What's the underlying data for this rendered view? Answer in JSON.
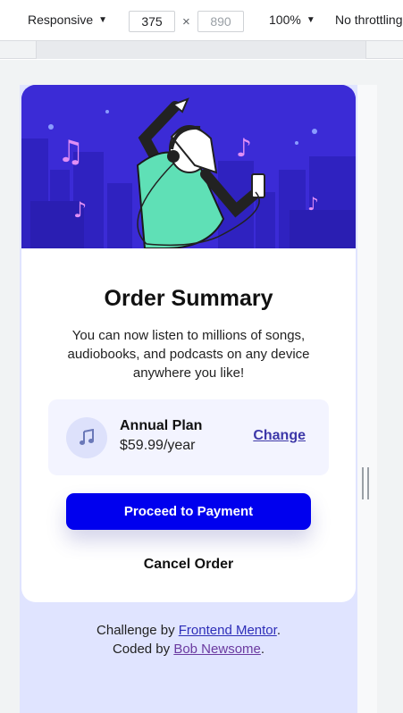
{
  "devtools": {
    "device_mode": "Responsive",
    "width": "375",
    "height": "890",
    "zoom": "100%",
    "throttling": "No throttling"
  },
  "card": {
    "title": "Order Summary",
    "description": "You can now listen to millions of songs, audiobooks, and podcasts on any device anywhere you like!",
    "plan": {
      "name": "Annual Plan",
      "price": "$59.99/year",
      "change_label": "Change",
      "icon": "music-note-icon"
    },
    "proceed_label": "Proceed to Payment",
    "cancel_label": "Cancel Order"
  },
  "attribution": {
    "challenge_prefix": "Challenge by ",
    "challenge_link": "Frontend Mentor",
    "challenge_suffix": ".",
    "coded_prefix": "Coded by ",
    "coded_link": "Bob Newsome",
    "coded_suffix": "."
  },
  "colors": {
    "hero_bg": "#3b2bd6",
    "button_primary": "#0000ee",
    "page_bg": "#e0e4ff",
    "plan_bg": "#f3f4ff",
    "link": "#3d38a8"
  }
}
